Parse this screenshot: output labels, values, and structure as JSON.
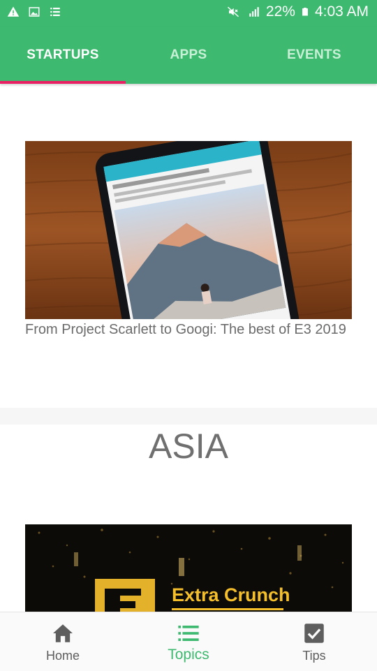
{
  "status_bar": {
    "battery": "22%",
    "time": "4:03 AM",
    "icons": [
      "warning-icon",
      "image-icon",
      "list-icon",
      "mute-icon",
      "signal-icon",
      "battery-icon"
    ]
  },
  "tabs": [
    {
      "label": "STARTUPS",
      "selected": true
    },
    {
      "label": "APPS",
      "selected": false
    },
    {
      "label": "EVENTS",
      "selected": false
    }
  ],
  "colors": {
    "primary": "#3dba6f",
    "indicator": "#e91e63"
  },
  "articles": [
    {
      "title": "From Project Scarlett to Googi: The best of E3 2019"
    }
  ],
  "section": {
    "title": "ASIA"
  },
  "card2": {
    "brand_text": "Extra Crunch"
  },
  "bottom_nav": [
    {
      "label": "Home",
      "icon": "home-icon",
      "active": false
    },
    {
      "label": "Topics",
      "icon": "list-icon",
      "active": true
    },
    {
      "label": "Tips",
      "icon": "checkbox-icon",
      "active": false
    }
  ]
}
